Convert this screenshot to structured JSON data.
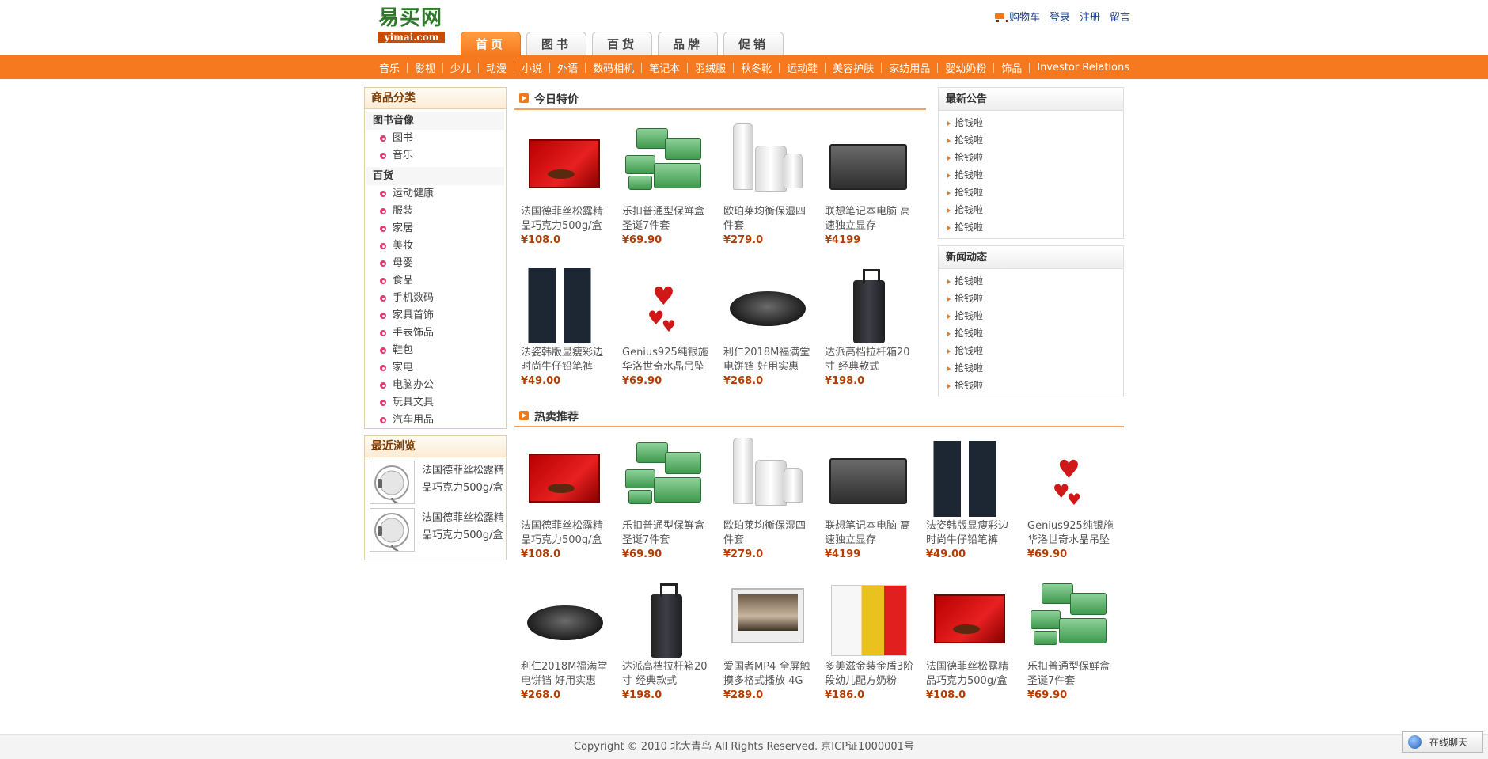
{
  "header": {
    "logo_cn": "易买网",
    "logo_en": "yimai.com",
    "links": [
      "购物车",
      "登录",
      "注册",
      "留言"
    ],
    "tabs": [
      {
        "label": "首页",
        "active": true
      },
      {
        "label": "图书",
        "active": false
      },
      {
        "label": "百货",
        "active": false
      },
      {
        "label": "品牌",
        "active": false
      },
      {
        "label": "促销",
        "active": false
      }
    ],
    "nav": [
      "音乐",
      "影视",
      "少儿",
      "动漫",
      "小说",
      "外语",
      "数码相机",
      "笔记本",
      "羽绒服",
      "秋冬靴",
      "运动鞋",
      "美容护肤",
      "家纺用品",
      "婴幼奶粉",
      "饰品",
      "Investor Relations"
    ]
  },
  "sidebar": {
    "category_title": "商品分类",
    "groups": [
      {
        "name": "图书音像",
        "items": [
          "图书",
          "音乐"
        ]
      },
      {
        "name": "百货",
        "items": [
          "运动健康",
          "服装",
          "家居",
          "美妆",
          "母婴",
          "食品",
          "手机数码",
          "家具首饰",
          "手表饰品",
          "鞋包",
          "家电",
          "电脑办公",
          "玩具文具",
          "汽车用品"
        ]
      }
    ],
    "recent_title": "最近浏览",
    "recent": [
      "法国德菲丝松露精品巧克力500g/盒",
      "法国德菲丝松露精品巧克力500g/盒"
    ]
  },
  "deals": {
    "title": "今日特价",
    "products": [
      {
        "name": "法国德菲丝松露精品巧克力500g/盒",
        "price": "¥108.0",
        "art": "choc"
      },
      {
        "name": "乐扣普通型保鲜盒圣诞7件套",
        "price": "¥69.90",
        "art": "box"
      },
      {
        "name": "欧珀莱均衡保湿四件套",
        "price": "¥279.0",
        "art": "cream"
      },
      {
        "name": "联想笔记本电脑 高速独立显存",
        "price": "¥4199",
        "art": "laptop"
      },
      {
        "name": "法姿韩版显瘦彩边时尚牛仔铅笔裤",
        "price": "¥49.00",
        "art": "jeans"
      },
      {
        "name": "Genius925纯银施华洛世奇水晶吊坠",
        "price": "¥69.90",
        "art": "heart"
      },
      {
        "name": "利仁2018M福满堂电饼铛 好用实惠",
        "price": "¥268.0",
        "art": "grill"
      },
      {
        "name": "达派高档拉杆箱20寸 经典款式",
        "price": "¥198.0",
        "art": "case"
      }
    ]
  },
  "hot": {
    "title": "热卖推荐",
    "products": [
      {
        "name": "法国德菲丝松露精品巧克力500g/盒",
        "price": "¥108.0",
        "art": "choc"
      },
      {
        "name": "乐扣普通型保鲜盒圣诞7件套",
        "price": "¥69.90",
        "art": "box"
      },
      {
        "name": "欧珀莱均衡保湿四件套",
        "price": "¥279.0",
        "art": "cream"
      },
      {
        "name": "联想笔记本电脑 高速独立显存",
        "price": "¥4199",
        "art": "laptop"
      },
      {
        "name": "法姿韩版显瘦彩边时尚牛仔铅笔裤",
        "price": "¥49.00",
        "art": "jeans"
      },
      {
        "name": "Genius925纯银施华洛世奇水晶吊坠",
        "price": "¥69.90",
        "art": "heart"
      },
      {
        "name": "利仁2018M福满堂电饼铛 好用实惠",
        "price": "¥268.0",
        "art": "grill"
      },
      {
        "name": "达派高档拉杆箱20寸 经典款式",
        "price": "¥198.0",
        "art": "case"
      },
      {
        "name": "爱国者MP4 全屏触摸多格式播放 4G",
        "price": "¥289.0",
        "art": "tablet"
      },
      {
        "name": "多美滋金装金盾3阶段幼儿配方奶粉",
        "price": "¥186.0",
        "art": "milk"
      },
      {
        "name": "法国德菲丝松露精品巧克力500g/盒",
        "price": "¥108.0",
        "art": "choc"
      },
      {
        "name": "乐扣普通型保鲜盒圣诞7件套",
        "price": "¥69.90",
        "art": "box"
      }
    ]
  },
  "notices": {
    "title": "最新公告",
    "items": [
      "抢钱啦",
      "抢钱啦",
      "抢钱啦",
      "抢钱啦",
      "抢钱啦",
      "抢钱啦",
      "抢钱啦"
    ]
  },
  "news": {
    "title": "新闻动态",
    "items": [
      "抢钱啦",
      "抢钱啦",
      "抢钱啦",
      "抢钱啦",
      "抢钱啦",
      "抢钱啦",
      "抢钱啦"
    ]
  },
  "footer": {
    "copyright": "Copyright © 2010 北大青鸟 All Rights Reserved. 京ICP证1000001号",
    "chat": "在线聊天"
  },
  "colors": {
    "accent": "#f7791f",
    "price": "#b53d00",
    "link": "#1d3f8a"
  }
}
